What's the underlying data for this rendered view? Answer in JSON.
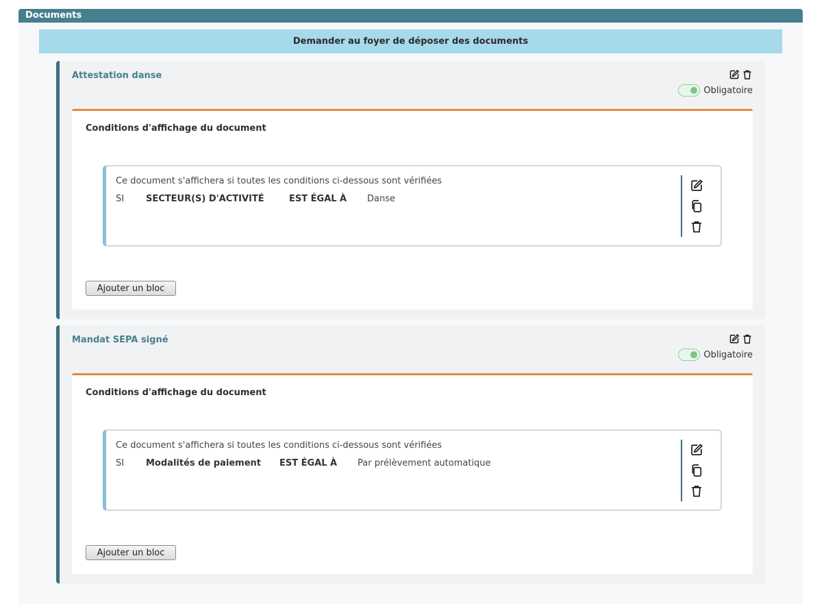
{
  "section": {
    "title": "Documents"
  },
  "request_banner": {
    "label": "Demander au foyer de déposer des documents"
  },
  "documents": [
    {
      "title": "Attestation danse",
      "required_label": "Obligatoire",
      "required": true,
      "conditions": {
        "title": "Conditions d'affichage du document",
        "block": {
          "description": "Ce document s'affichera si toutes les conditions ci-dessous sont vérifiées",
          "si": "SI",
          "field": "SECTEUR(S) D'ACTIVITÉ",
          "operator": "EST ÉGAL À",
          "value": "Danse"
        },
        "add_block_label": "Ajouter un bloc"
      }
    },
    {
      "title": "Mandat SEPA signé",
      "required_label": "Obligatoire",
      "required": true,
      "conditions": {
        "title": "Conditions d'affichage du document",
        "block": {
          "description": "Ce document s'affichera si toutes les conditions ci-dessous sont vérifiées",
          "si": "SI",
          "field": "Modalités de paiement",
          "operator": "EST ÉGAL À",
          "value": "Par prélèvement automatique"
        },
        "add_block_label": "Ajouter un bloc"
      }
    }
  ],
  "icons": {
    "edit": "edit-icon",
    "delete": "trash-icon",
    "copy": "copy-icon"
  },
  "colors": {
    "header": "#467f8e",
    "banner": "#a6d9ea",
    "accent_orange": "#e5883a",
    "toggle_on": "#7cc48c"
  }
}
